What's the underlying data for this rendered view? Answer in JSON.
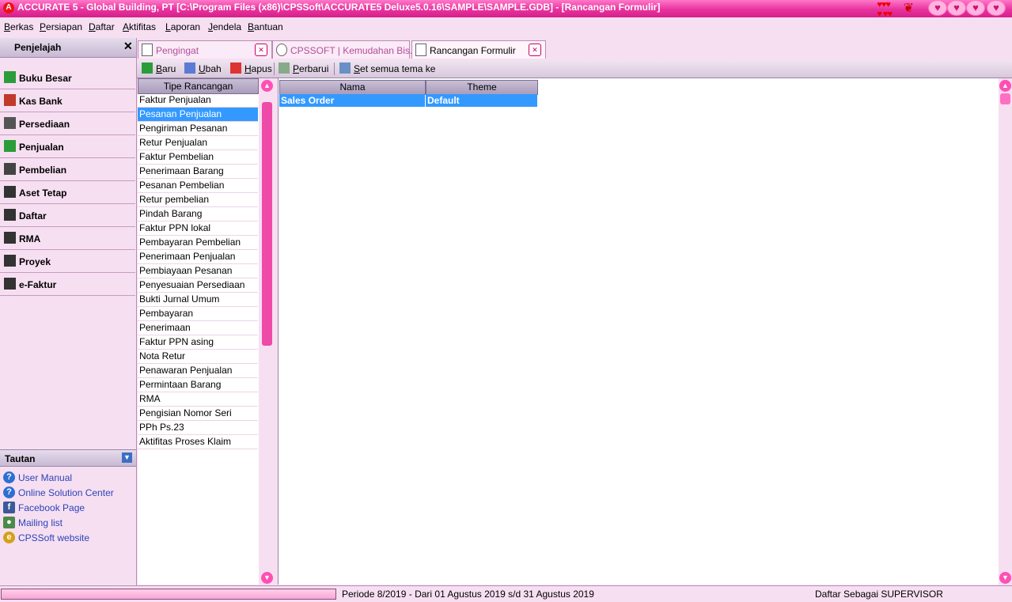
{
  "window": {
    "logo_letter": "A",
    "title": "ACCURATE 5  - Global Building, PT   [C:\\Program Files (x86)\\CPSSoft\\ACCURATE5 Deluxe5.0.16\\SAMPLE\\SAMPLE.GDB] - [Rancangan Formulir]"
  },
  "menu": [
    "Berkas",
    "Persiapan",
    "Daftar",
    "Aktifitas",
    "Laporan",
    "Jendela",
    "Bantuan"
  ],
  "explorer": {
    "title": "Penjelajah",
    "items": [
      {
        "label": "Buku Besar",
        "icon": "ledger-icon"
      },
      {
        "label": "Kas Bank",
        "icon": "cash-bank-icon"
      },
      {
        "label": "Persediaan",
        "icon": "inventory-icon"
      },
      {
        "label": "Penjualan",
        "icon": "sales-icon"
      },
      {
        "label": "Pembelian",
        "icon": "cart-icon"
      },
      {
        "label": "Aset Tetap",
        "icon": "house-icon"
      },
      {
        "label": "Daftar",
        "icon": "list-icon"
      },
      {
        "label": "RMA",
        "icon": "rma-icon"
      },
      {
        "label": "Proyek",
        "icon": "project-icon"
      },
      {
        "label": "e-Faktur",
        "icon": "efaktur-icon"
      }
    ]
  },
  "links": {
    "title": "Tautan",
    "items": [
      {
        "label": "User Manual",
        "icon": "help-icon"
      },
      {
        "label": "Online Solution Center",
        "icon": "help-icon"
      },
      {
        "label": "Facebook Page",
        "icon": "facebook-icon"
      },
      {
        "label": "Mailing list",
        "icon": "people-icon"
      },
      {
        "label": "CPSSoft website",
        "icon": "web-icon"
      }
    ]
  },
  "tabs": [
    {
      "label": "Pengingat",
      "active": false
    },
    {
      "label": "CPSSOFT | Kemudahan Bis...",
      "active": false
    },
    {
      "label": "Rancangan Formulir",
      "active": true
    }
  ],
  "toolbar": {
    "new": "Baru",
    "edit": "Ubah",
    "delete": "Hapus",
    "refresh": "Perbarui",
    "set_theme": "Set semua tema ke"
  },
  "type_list": {
    "header": "Tipe Rancangan",
    "selected_index": 1,
    "items": [
      "Faktur Penjualan",
      "Pesanan Penjualan",
      "Pengiriman Pesanan",
      "Retur Penjualan",
      "Faktur Pembelian",
      "Penerimaan Barang",
      "Pesanan Pembelian",
      "Retur pembelian",
      "Pindah Barang",
      "Faktur PPN lokal",
      "Pembayaran Pembelian",
      "Penerimaan Penjualan",
      "Pembiayaan Pesanan",
      "Penyesuaian Persediaan",
      "Bukti Jurnal Umum",
      "Pembayaran",
      "Penerimaan",
      "Faktur PPN asing",
      "Nota Retur",
      "Penawaran Penjualan",
      "Permintaan Barang",
      "RMA",
      "Pengisian Nomor Seri",
      "PPh Ps.23",
      "Aktifitas Proses Klaim"
    ]
  },
  "grid": {
    "columns": [
      "Nama",
      "Theme"
    ],
    "rows": [
      [
        "Sales Order",
        "Default"
      ]
    ]
  },
  "status": {
    "period": "Periode 8/2019 - Dari 01 Agustus 2019 s/d 31 Agustus 2019",
    "user": "Daftar Sebagai SUPERVISOR"
  }
}
